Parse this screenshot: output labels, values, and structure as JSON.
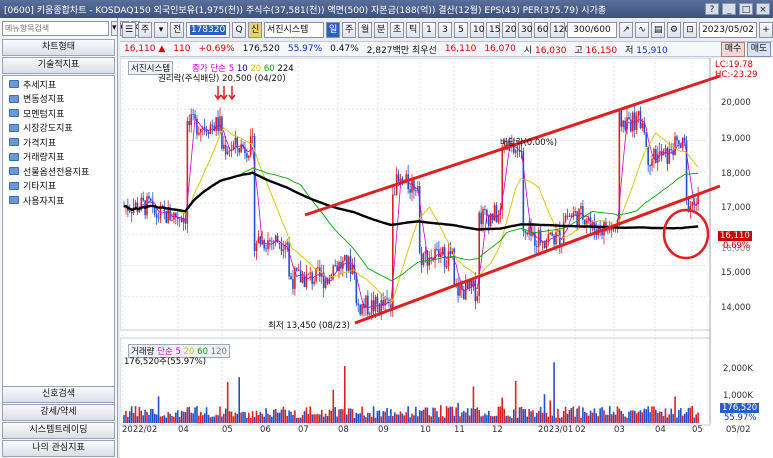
{
  "window": {
    "title": "[0600] 키움종합차트 - KOSDAQ150 외국인보유(1,975(천)) 주식수(37,581(천)) 액면(500) 자본금(188(억)) 결산(12월) EPS(43) PER(375.79) 시가총",
    "btn_help": "?",
    "btn_min": "_",
    "btn_max": "□",
    "btn_close": "×"
  },
  "sidebar": {
    "search_placeholder": "메뉴항목검색",
    "search_btn": "▾",
    "search_btn2": "Q",
    "search_btn3": "✕",
    "chart_type_label": "차트형태",
    "tech_label": "기술적지표",
    "items": [
      "추세지표",
      "변동성지표",
      "모멘텀지표",
      "시장강도지표",
      "가격지표",
      "거래량지표",
      "선물옵션전용지표",
      "기타지표",
      "사용자지표"
    ],
    "bottom_buttons": [
      "신호검색",
      "강세/약세",
      "시스템트레이딩",
      "나의 관심지표"
    ]
  },
  "toolbar": {
    "menu_btn": "☰",
    "period_btn": "주",
    "arrow_btn": "▾",
    "jeon_btn": "전",
    "code_value": "178320",
    "search_btn": "Q",
    "sin_btn": "신",
    "stock_name": "서진시스템",
    "tabs": [
      "일",
      "주",
      "월",
      "분",
      "초",
      "틱"
    ],
    "active_tab": 0,
    "intervals": [
      "1",
      "3",
      "5",
      "10",
      "15",
      "20",
      "30",
      "60",
      "120"
    ],
    "count_value": "300/600",
    "date_value": "2023/05/02",
    "tool_icons": [
      "line-chart-icon",
      "indicator-icon",
      "print-icon",
      "settings-icon",
      "lock-icon",
      "window-icon",
      "refresh-icon",
      "add-icon"
    ]
  },
  "pricebar": {
    "price": "16,110",
    "change_mark": "▲",
    "change": "110",
    "change_pct": "+0.69%",
    "volume": "176,520",
    "vol_ratio": "55.97%",
    "turnover": "0.47%",
    "amount": "2,827백만",
    "best_ask_label": "최우선",
    "best_ask": "16,110",
    "best_bid": "16,070",
    "open_label": "시",
    "open": "16,030",
    "high_label": "고",
    "high": "16,150",
    "low_label": "저",
    "low": "15,910",
    "buy_label": "매수",
    "sell_label": "매도"
  },
  "chart": {
    "tag": "서진시스템",
    "legend": [
      {
        "text": "종가 단순",
        "color": "#cc00cc"
      },
      {
        "text": "5",
        "color": "#cc00cc"
      },
      {
        "text": "10",
        "color": "#0000cc"
      },
      {
        "text": "20",
        "color": "#dddd00"
      },
      {
        "text": "60",
        "color": "#00aa00"
      },
      {
        "text": "224",
        "color": "#000000"
      }
    ],
    "top_note": "권리락(주식배당) 20,500 (04/20)",
    "high_tag": "LC:19.78",
    "low_tag": "HC:-23.29",
    "annotation_mid": "배당락(0.00%)",
    "low_note": "최저 13,450 (08/23)",
    "current_price_tag": "16,110",
    "current_pct_tag": "0.69%",
    "volume_tag": "176,520",
    "volume_pct_tag": "55.97%",
    "price_axis": [
      "20,000",
      "19,000",
      "18,000",
      "17,000",
      "16,000",
      "15,000",
      "14,000"
    ],
    "volume_axis": [
      "2,000K",
      "1,000K"
    ],
    "x_axis": [
      "2022/02",
      "04",
      "05",
      "06",
      "07",
      "08",
      "09",
      "10",
      "11",
      "12",
      "2023/01",
      "02",
      "03",
      "04",
      "05",
      "05/02"
    ],
    "volume_legend_name": "거래량",
    "volume_legend": [
      {
        "text": "단순",
        "color": "#cc00cc"
      },
      {
        "text": "5",
        "color": "#cc00cc"
      },
      {
        "text": "20",
        "color": "#dddd00"
      },
      {
        "text": "60",
        "color": "#00aa00"
      },
      {
        "text": "120",
        "color": "#777777"
      }
    ],
    "volume_sub": "176,520주(55.97%)",
    "colors": {
      "up": "#e02020",
      "down": "#1f4fd0",
      "ma224": "#000000",
      "trend": "#e02020"
    }
  }
}
